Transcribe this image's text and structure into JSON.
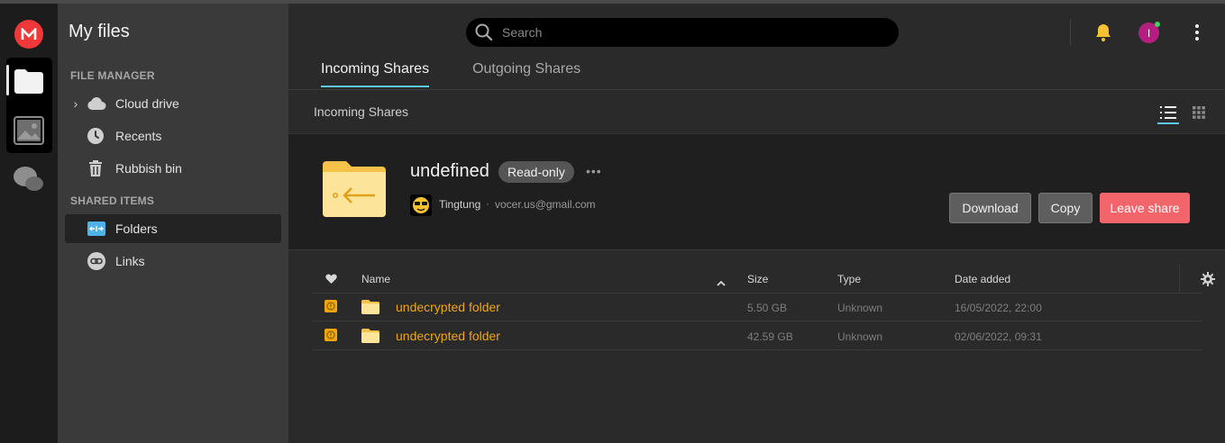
{
  "app": {
    "title": "My files",
    "accent_color": "#5ec8f0",
    "brand_color": "#f0373a"
  },
  "rail": {
    "items": [
      {
        "icon": "mega-logo-icon"
      },
      {
        "icon": "folder-icon",
        "active": true
      },
      {
        "icon": "photos-icon"
      },
      {
        "icon": "chat-icon"
      }
    ]
  },
  "sidebar": {
    "title": "My files",
    "section_file_manager": "FILE MANAGER",
    "section_shared": "SHARED ITEMS",
    "items": [
      {
        "label": "Cloud drive",
        "icon": "cloud-icon"
      },
      {
        "label": "Recents",
        "icon": "clock-icon"
      },
      {
        "label": "Rubbish bin",
        "icon": "trash-icon"
      },
      {
        "label": "Folders",
        "icon": "shared-folder-icon",
        "active": true
      },
      {
        "label": "Links",
        "icon": "link-icon"
      }
    ]
  },
  "header": {
    "search_placeholder": "Search",
    "avatar_initial": "I"
  },
  "tabs": [
    {
      "label": "Incoming Shares",
      "active": true
    },
    {
      "label": "Outgoing Shares",
      "active": false
    }
  ],
  "breadcrumb": "Incoming Shares",
  "share": {
    "name": "undefined",
    "badge": "Read-only",
    "more": "•••",
    "owner_name": "Tingtung",
    "separator": "·",
    "owner_email": "vocer.us@gmail.com",
    "download_label": "Download",
    "copy_label": "Copy",
    "leave_label": "Leave share"
  },
  "table": {
    "columns": {
      "name": "Name",
      "size": "Size",
      "type": "Type",
      "date": "Date added"
    },
    "rows": [
      {
        "name": "undecrypted folder",
        "size": "5.50 GB",
        "type": "Unknown",
        "date": "16/05/2022, 22:00"
      },
      {
        "name": "undecrypted folder",
        "size": "42.59 GB",
        "type": "Unknown",
        "date": "02/06/2022, 09:31"
      }
    ]
  }
}
